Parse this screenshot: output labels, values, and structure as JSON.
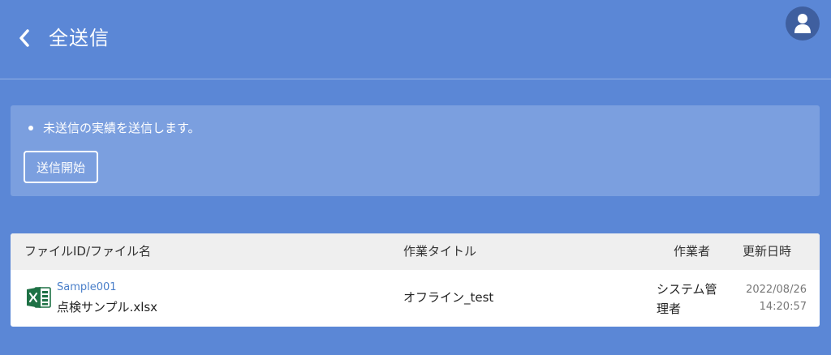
{
  "header": {
    "title": "全送信",
    "back_icon": "chevron-left-icon",
    "avatar_icon": "user-icon"
  },
  "info": {
    "notice": "未送信の実績を送信します。",
    "start_button": "送信開始"
  },
  "table": {
    "columns": {
      "file": "ファイルID/ファイル名",
      "title": "作業タイトル",
      "worker": "作業者",
      "updated": "更新日時"
    },
    "rows": [
      {
        "file_icon": "excel-icon",
        "file_id": "Sample001",
        "file_name": "点検サンプル.xlsx",
        "title": "オフライン_test",
        "worker": "システム管理者",
        "updated_date": "2022/08/26",
        "updated_time": "14:20:57"
      }
    ]
  },
  "colors": {
    "background": "#5b87d6",
    "panel": "#7b9fdf",
    "avatar": "#3f5f9f",
    "link": "#4a7fc9",
    "excel_green": "#1e7145"
  }
}
